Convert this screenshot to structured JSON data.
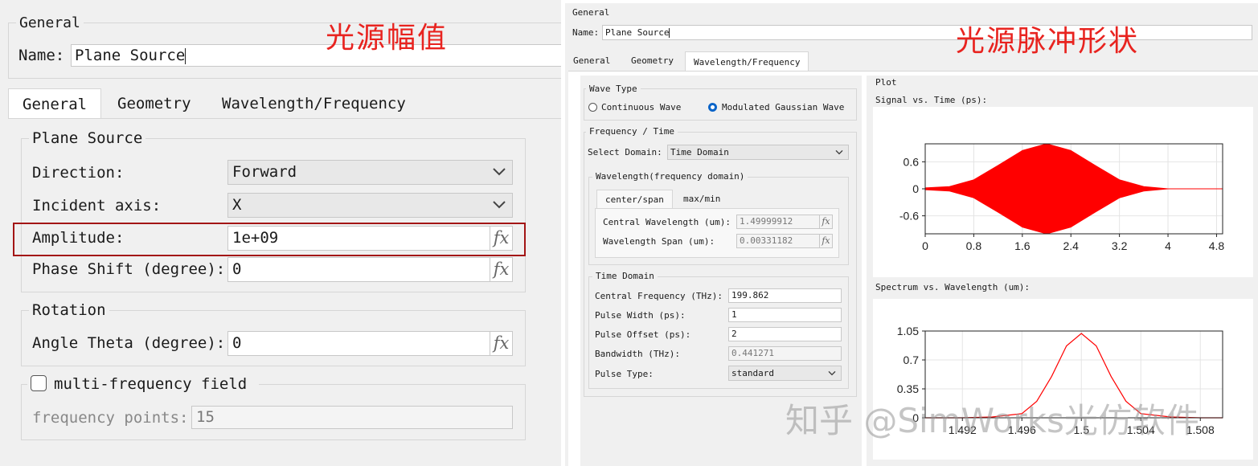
{
  "annotations": {
    "left_title": "光源幅值",
    "right_title": "光源脉冲形状",
    "watermark": "知乎 @SimWorks光仿软件"
  },
  "left": {
    "general_group": "General",
    "name_label": "Name:",
    "name_value": "Plane Source",
    "tabs": [
      "General",
      "Geometry",
      "Wavelength/Frequency"
    ],
    "plane_source_group": "Plane Source",
    "direction_label": "Direction:",
    "direction_value": "Forward",
    "incident_axis_label": "Incident axis:",
    "incident_axis_value": "X",
    "amplitude_label": "Amplitude:",
    "amplitude_value": "1e+09",
    "phase_shift_label": "Phase Shift (degree):",
    "phase_shift_value": "0",
    "rotation_group": "Rotation",
    "angle_theta_label": "Angle Theta (degree):",
    "angle_theta_value": "0",
    "multi_freq_label": "multi-frequency field",
    "multi_freq_checked": false,
    "freq_points_label": "frequency points:",
    "freq_points_value": "15",
    "highlight_color": "#a31515"
  },
  "right": {
    "general_group": "General",
    "name_label": "Name:",
    "name_value": "Plane Source",
    "tabs": [
      "General",
      "Geometry",
      "Wavelength/Frequency"
    ],
    "wave_type_group": "Wave Type",
    "wave_continuous": "Continuous Wave",
    "wave_gaussian": "Modulated Gaussian Wave",
    "freq_time_group": "Frequency / Time",
    "select_domain_label": "Select Domain:",
    "select_domain_value": "Time Domain",
    "wl_group": "Wavelength(frequency domain)",
    "subtabs": [
      "center/span",
      "max/min"
    ],
    "central_wl_label": "Central Wavelength (um):",
    "central_wl_value": "1.49999912",
    "wl_span_label": "Wavelength Span (um):",
    "wl_span_value": "0.00331182",
    "time_domain_group": "Time Domain",
    "central_freq_label": "Central Frequency (THz):",
    "central_freq_value": "199.862",
    "pulse_width_label": "Pulse Width (ps):",
    "pulse_width_value": "1",
    "pulse_offset_label": "Pulse Offset (ps):",
    "pulse_offset_value": "2",
    "bandwidth_label": "Bandwidth (THz):",
    "bandwidth_value": "0.441271",
    "pulse_type_label": "Pulse Type:",
    "pulse_type_value": "standard",
    "plot_group": "Plot",
    "signal_title": "Signal vs. Time (ps):",
    "spectrum_title": "Spectrum vs. Wavelength (um):",
    "accent_color": "#0a64c8"
  },
  "chart_data": [
    {
      "type": "line",
      "title": "Signal vs. Time (ps):",
      "xlabel": "",
      "ylabel": "",
      "series": [
        {
          "x": [
            0,
            0.4,
            0.8,
            1.2,
            1.6,
            2.0,
            2.4,
            2.8,
            3.2,
            3.6,
            4.0,
            4.9
          ],
          "y": [
            0.02,
            0.05,
            0.2,
            0.52,
            0.85,
            1.0,
            0.85,
            0.52,
            0.2,
            0.05,
            0.0,
            0.0
          ]
        }
      ],
      "envelope": "symmetric filled",
      "xlim": [
        0,
        4.9
      ],
      "ylim": [
        -1.0,
        1.0
      ],
      "xticks": [
        "0",
        "0.8",
        "1.6",
        "2.4",
        "3.2",
        "4",
        "4.8"
      ],
      "yticks": [
        "0.6",
        "0",
        "-0.6"
      ],
      "color": "#ff0000",
      "grid": true
    },
    {
      "type": "line",
      "title": "Spectrum vs. Wavelength (um):",
      "xlabel": "",
      "ylabel": "",
      "series": [
        {
          "x": [
            1.4895,
            1.492,
            1.494,
            1.496,
            1.497,
            1.498,
            1.499,
            1.5,
            1.501,
            1.502,
            1.503,
            1.504,
            1.506,
            1.508,
            1.5095
          ],
          "y": [
            0.0,
            0.0,
            0.01,
            0.05,
            0.2,
            0.5,
            0.87,
            1.02,
            0.87,
            0.5,
            0.2,
            0.05,
            0.01,
            0.0,
            0.0
          ]
        }
      ],
      "xlim": [
        1.4895,
        1.5095
      ],
      "ylim": [
        0,
        1.05
      ],
      "xticks": [
        "1.492",
        "1.496",
        "1.5",
        "1.504",
        "1.508"
      ],
      "yticks": [
        "1.05",
        "0.7",
        "0.35",
        "0"
      ],
      "color": "#ff0000",
      "grid": true
    }
  ]
}
